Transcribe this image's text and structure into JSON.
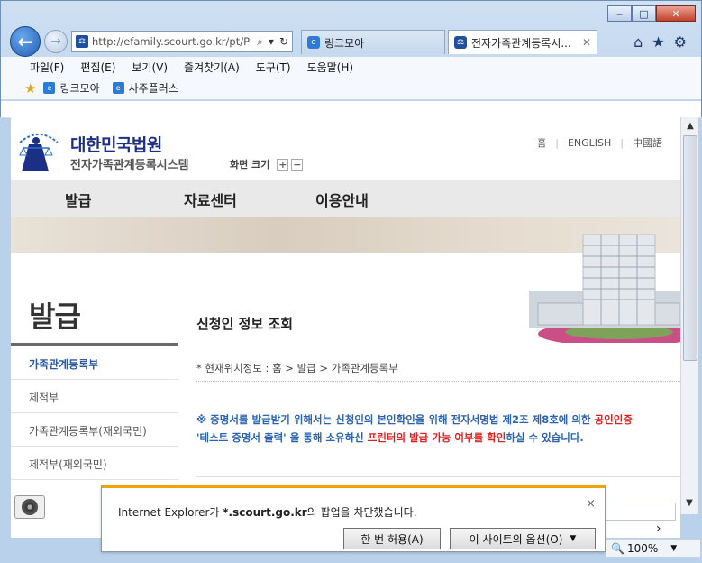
{
  "window": {
    "minimize": "‒",
    "maximize": "□",
    "close": "✕"
  },
  "nav": {
    "back": "←",
    "forward": "→",
    "url": "http://efamily.scourt.go.kr/pt/P",
    "search_icon": "⌕",
    "refresh_icon": "↻"
  },
  "tabs": [
    {
      "label": "링크모아"
    },
    {
      "label": "전자가족관계등록시...",
      "close": "✕"
    }
  ],
  "toolbar_icons": {
    "home": "⌂",
    "favorites": "★",
    "tools": "⚙"
  },
  "menu": [
    "파일(F)",
    "편집(E)",
    "보기(V)",
    "즐겨찾기(A)",
    "도구(T)",
    "도움말(H)"
  ],
  "favorites_bar": [
    "링크모아",
    "사주플러스"
  ],
  "site": {
    "logo_main": "대한민국법원",
    "logo_sub": "전자가족관계등록시스템",
    "font_size_label": "화면 크기",
    "font_plus": "+",
    "font_minus": "−",
    "util_links": [
      "홈",
      "ENGLISH",
      "中國語"
    ],
    "gnb": [
      "발급",
      "자료센터",
      "이용안내"
    ],
    "side_title": "발급",
    "side_menu": [
      "가족관계등록부",
      "제적부",
      "가족관계등록부(재외국민)",
      "제적부(재외국민)"
    ],
    "content_title": "신청인 정보 조회",
    "breadcrumb": "* 현재위치정보 : 홈 > 발급 > 가족관계등록부",
    "notice": {
      "part1": "※ 증명서를 발급받기 위해서는 신청인의 본인확인을 위해 전자서명법 제2조 제8호에 의한 ",
      "part1_red": "공인인증",
      "part2": "'테스트 증명서 출력' 을 통해 소유하신 ",
      "part2_red": "프린터의 발급 가능 여부를 확인",
      "part3": "하실 수 있습니다."
    }
  },
  "popup_bar": {
    "message_prefix": "Internet Explorer가 ",
    "message_site": "*.scourt.go.kr",
    "message_suffix": "의 팝업을 차단했습니다.",
    "close": "×",
    "allow_once": "한 번 허용(A)",
    "site_options": "이 사이트의 옵션(O)",
    "dropdown": "▼"
  },
  "statusbar": {
    "zoom": "100%"
  }
}
